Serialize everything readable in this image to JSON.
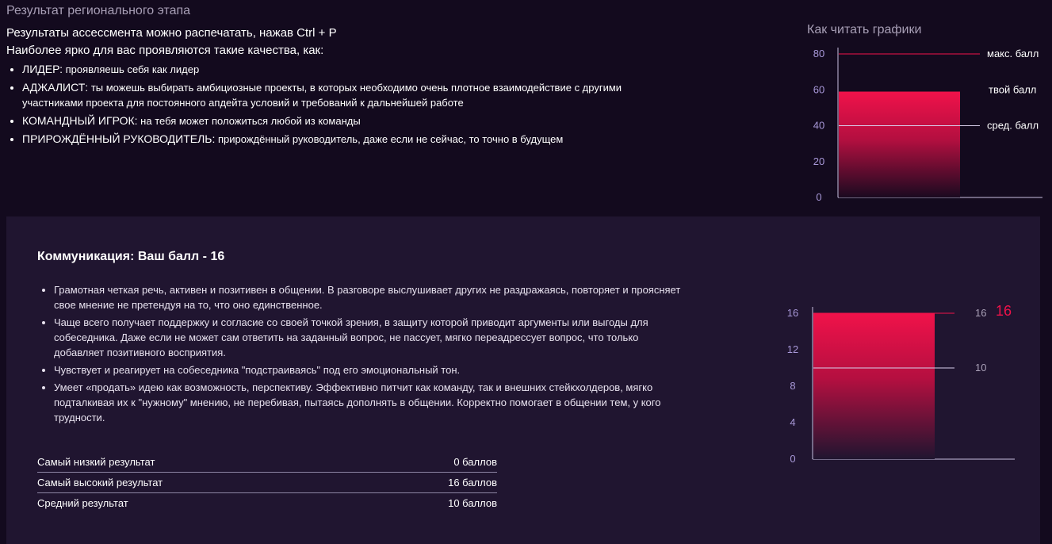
{
  "header": {
    "title": "Результат регионального этапа",
    "print_hint": "Результаты ассессмента можно распечатать, нажав Ctrl + P",
    "qualities_intro": "Наиболее ярко для вас проявляются такие качества, как:"
  },
  "qualities": [
    {
      "name": "ЛИДЕР:",
      "text": "проявляешь себя как лидер"
    },
    {
      "name": "АДЖАЛИСТ:",
      "text": "ты можешь выбирать амбициозные проекты, в которых необходимо очень плотное взаимодействие с другими участниками проекта для постоянного апдейта условий и требований к дальнейшей работе"
    },
    {
      "name": "КОМАНДНЫЙ ИГРОК:",
      "text": "на тебя может положиться любой из команды"
    },
    {
      "name": "ПРИРОЖДЁННЫЙ РУКОВОДИТЕЛЬ:",
      "text": "прирождённый руководитель, даже если не сейчас, то точно в будущем"
    }
  ],
  "legend_chart": {
    "title": "Как читать графики",
    "y_ticks": [
      "80",
      "60",
      "40",
      "20",
      "0"
    ],
    "ylim": [
      0,
      80
    ],
    "max_value": 80,
    "your_value": 59,
    "avg_value": 40,
    "max_label": "макс. балл",
    "your_label": "твой балл",
    "avg_label": "сред. балл"
  },
  "competency": {
    "title": "Коммуникация: Ваш балл - 16",
    "descriptions": [
      "Грамотная четкая речь, активен и позитивен в общении. В разговоре выслушивает других не раздражаясь, повторяет и проясняет свое мнение не претендуя на то, что оно единственное.",
      "Чаще всего получает поддержку и согласие со своей точкой зрения, в защиту которой приводит аргументы или выгоды для собеседника. Даже если не может сам ответить на заданный вопрос, не пассует, мягко переадрессует вопрос, что только добавляет позитивного восприятия.",
      "Чувствует и реагирует на собеседника \"подстраиваясь\" под его эмоциональный тон.",
      "Умеет «продать» идею как возможность, перспективу. Эффективно питчит как команду, так и внешних стейкхолдеров, мягко подталкивая их к \"нужному\" мнению, не перебивая, пытаясь дополнять в общении. Корректно помогает в общении тем, у кого трудности."
    ],
    "stats": [
      {
        "label": "Самый низкий результат",
        "value": "0 баллов"
      },
      {
        "label": "Самый высокий результат",
        "value": "16 баллов"
      },
      {
        "label": "Средний результат",
        "value": "10 баллов"
      }
    ]
  },
  "chart_data": {
    "type": "bar",
    "y_ticks": [
      "16",
      "12",
      "8",
      "4",
      "0"
    ],
    "ylim": [
      0,
      16
    ],
    "score": 16,
    "max_value": 16,
    "avg_value": 10,
    "max_label": "16",
    "avg_label": "10",
    "score_label": "16"
  },
  "colors": {
    "accent": "#f0124a",
    "bar_top": "#f0124a",
    "bar_bottom": "#2a0a26",
    "muted_text": "#a89fb6",
    "axis": "#b8b0cc"
  }
}
